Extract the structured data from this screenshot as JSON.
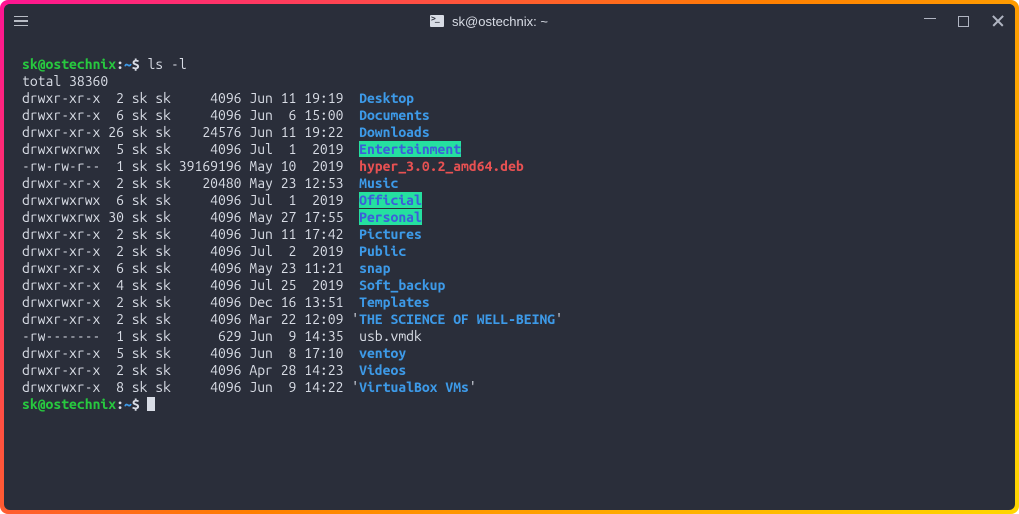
{
  "window": {
    "title": "sk@ostechnix: ~"
  },
  "prompt": {
    "user": "sk",
    "at": "@",
    "host": "ostechnix",
    "colon": ":",
    "path": "~",
    "symbol": "$"
  },
  "command": "ls -l",
  "total_line": "total 38360",
  "rows": [
    {
      "perm": "drwxr-xr-x",
      "links": "2",
      "owner": "sk",
      "group": "sk",
      "size": "4096",
      "month": "Jun",
      "day": "11",
      "timeyr": "19:19",
      "name": "Desktop",
      "cls": "dir",
      "prefix": " ",
      "suffix": ""
    },
    {
      "perm": "drwxr-xr-x",
      "links": "6",
      "owner": "sk",
      "group": "sk",
      "size": "4096",
      "month": "Jun",
      "day": "6",
      "timeyr": "15:00",
      "name": "Documents",
      "cls": "dir",
      "prefix": " ",
      "suffix": ""
    },
    {
      "perm": "drwxr-xr-x",
      "links": "26",
      "owner": "sk",
      "group": "sk",
      "size": "24576",
      "month": "Jun",
      "day": "11",
      "timeyr": "19:22",
      "name": "Downloads",
      "cls": "dir",
      "prefix": " ",
      "suffix": ""
    },
    {
      "perm": "drwxrwxrwx",
      "links": "5",
      "owner": "sk",
      "group": "sk",
      "size": "4096",
      "month": "Jul",
      "day": "1",
      "timeyr": "2019",
      "name": "Entertainment",
      "cls": "wdir",
      "prefix": " ",
      "suffix": ""
    },
    {
      "perm": "-rw-rw-r--",
      "links": "1",
      "owner": "sk",
      "group": "sk",
      "size": "39169196",
      "month": "May",
      "day": "10",
      "timeyr": "2019",
      "name": "hyper_3.0.2_amd64.deb",
      "cls": "deb",
      "prefix": " ",
      "suffix": ""
    },
    {
      "perm": "drwxr-xr-x",
      "links": "2",
      "owner": "sk",
      "group": "sk",
      "size": "20480",
      "month": "May",
      "day": "23",
      "timeyr": "12:53",
      "name": "Music",
      "cls": "dir",
      "prefix": " ",
      "suffix": ""
    },
    {
      "perm": "drwxrwxrwx",
      "links": "6",
      "owner": "sk",
      "group": "sk",
      "size": "4096",
      "month": "Jul",
      "day": "1",
      "timeyr": "2019",
      "name": "Official",
      "cls": "wdir",
      "prefix": " ",
      "suffix": ""
    },
    {
      "perm": "drwxrwxrwx",
      "links": "30",
      "owner": "sk",
      "group": "sk",
      "size": "4096",
      "month": "May",
      "day": "27",
      "timeyr": "17:55",
      "name": "Personal",
      "cls": "wdir",
      "prefix": " ",
      "suffix": ""
    },
    {
      "perm": "drwxr-xr-x",
      "links": "2",
      "owner": "sk",
      "group": "sk",
      "size": "4096",
      "month": "Jun",
      "day": "11",
      "timeyr": "17:42",
      "name": "Pictures",
      "cls": "dir",
      "prefix": " ",
      "suffix": ""
    },
    {
      "perm": "drwxr-xr-x",
      "links": "2",
      "owner": "sk",
      "group": "sk",
      "size": "4096",
      "month": "Jul",
      "day": "2",
      "timeyr": "2019",
      "name": "Public",
      "cls": "dir",
      "prefix": " ",
      "suffix": ""
    },
    {
      "perm": "drwxr-xr-x",
      "links": "6",
      "owner": "sk",
      "group": "sk",
      "size": "4096",
      "month": "May",
      "day": "23",
      "timeyr": "11:21",
      "name": "snap",
      "cls": "dir",
      "prefix": " ",
      "suffix": ""
    },
    {
      "perm": "drwxr-xr-x",
      "links": "4",
      "owner": "sk",
      "group": "sk",
      "size": "4096",
      "month": "Jul",
      "day": "25",
      "timeyr": "2019",
      "name": "Soft_backup",
      "cls": "dir",
      "prefix": " ",
      "suffix": ""
    },
    {
      "perm": "drwxrwxr-x",
      "links": "2",
      "owner": "sk",
      "group": "sk",
      "size": "4096",
      "month": "Dec",
      "day": "16",
      "timeyr": "13:51",
      "name": "Templates",
      "cls": "dir",
      "prefix": " ",
      "suffix": ""
    },
    {
      "perm": "drwxr-xr-x",
      "links": "2",
      "owner": "sk",
      "group": "sk",
      "size": "4096",
      "month": "Mar",
      "day": "22",
      "timeyr": "12:09",
      "name": "THE SCIENCE OF WELL-BEING",
      "cls": "dir",
      "prefix": "'",
      "suffix": "'"
    },
    {
      "perm": "-rw-------",
      "links": "1",
      "owner": "sk",
      "group": "sk",
      "size": "629",
      "month": "Jun",
      "day": "9",
      "timeyr": "14:35",
      "name": "usb.vmdk",
      "cls": "file",
      "prefix": " ",
      "suffix": ""
    },
    {
      "perm": "drwxr-xr-x",
      "links": "5",
      "owner": "sk",
      "group": "sk",
      "size": "4096",
      "month": "Jun",
      "day": "8",
      "timeyr": "17:10",
      "name": "ventoy",
      "cls": "dir",
      "prefix": " ",
      "suffix": ""
    },
    {
      "perm": "drwxr-xr-x",
      "links": "2",
      "owner": "sk",
      "group": "sk",
      "size": "4096",
      "month": "Apr",
      "day": "28",
      "timeyr": "14:23",
      "name": "Videos",
      "cls": "dir",
      "prefix": " ",
      "suffix": ""
    },
    {
      "perm": "drwxrwxr-x",
      "links": "8",
      "owner": "sk",
      "group": "sk",
      "size": "4096",
      "month": "Jun",
      "day": "9",
      "timeyr": "14:22",
      "name": "VirtualBox VMs",
      "cls": "dir",
      "prefix": "'",
      "suffix": "'"
    }
  ]
}
